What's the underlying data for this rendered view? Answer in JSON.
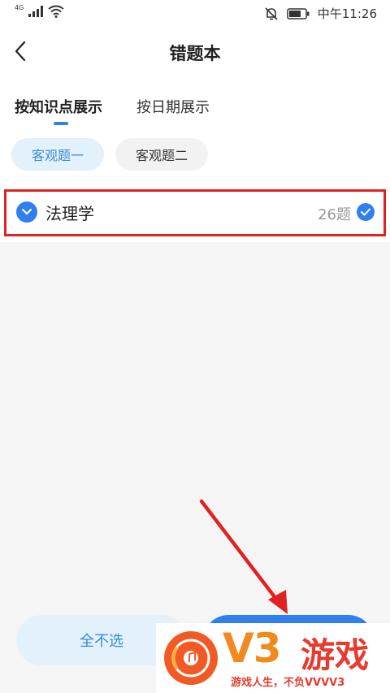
{
  "status_bar": {
    "network": "4G",
    "time": "中午11:26",
    "icons": [
      "signal-icon",
      "wifi-icon",
      "mute-bell-icon",
      "battery-icon"
    ]
  },
  "header": {
    "title": "错题本",
    "back_icon": "chevron-left-icon"
  },
  "tabs": [
    {
      "label": "按知识点展示",
      "active": true
    },
    {
      "label": "按日期展示",
      "active": false
    }
  ],
  "filters": [
    {
      "label": "客观题一",
      "selected": true
    },
    {
      "label": "客观题二",
      "selected": false
    }
  ],
  "subjects": [
    {
      "label": "法理学",
      "count": "26题",
      "checked": true
    }
  ],
  "footer": {
    "deselect_all_label": "全不选"
  },
  "watermark": {
    "brand": "V3",
    "brand_cn": "游戏",
    "slogan": "游戏人生，不负VVVV3"
  },
  "colors": {
    "accent": "#2f80ed",
    "accent_light": "#e3f1fc",
    "annotation_red": "#e02222",
    "background": "#f5f5f5"
  }
}
